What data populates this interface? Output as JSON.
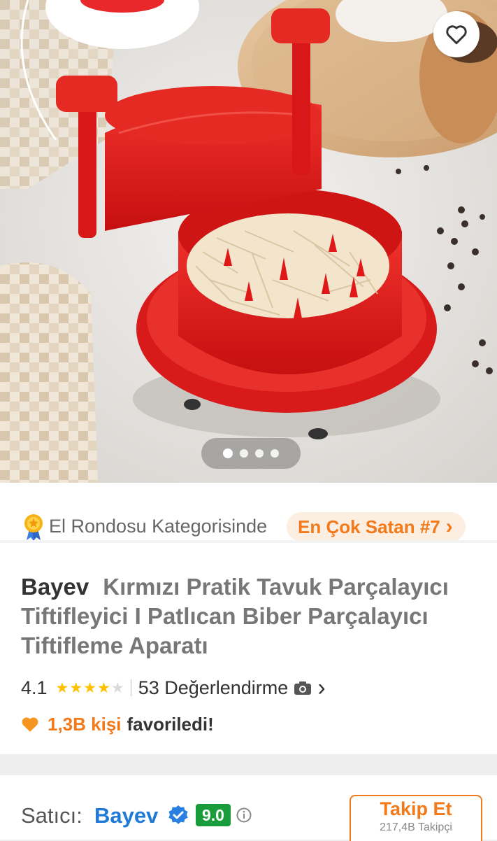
{
  "hero": {
    "pager": {
      "count": 4,
      "active": 0
    }
  },
  "bestseller": {
    "category_text": "El Rondosu Kategorisinde",
    "badge_label": "En Çok Satan #7",
    "badge_chevron": "›"
  },
  "product": {
    "brand": "Bayev",
    "title": "Kırmızı Pratik Tavuk Parçalayıcı Tiftifleyici I Patlıcan Biber Parçalayıcı Tiftifleme Aparatı",
    "rating": "4.1",
    "stars": {
      "filled": 4,
      "total": 5
    },
    "reviews_label": "53 Değerlendirme",
    "review_chevron": "›",
    "favorites_count": "1,3B kişi",
    "favorites_text": "favoriledi!"
  },
  "seller": {
    "label": "Satıcı:",
    "name": "Bayev",
    "score": "9.0",
    "follow_label": "Takip Et",
    "follow_sub": "217,4B Takipçi"
  },
  "colors": {
    "accent": "#f27a1a",
    "badge_bg": "#fdeee2",
    "seller_link": "#1f7ad6",
    "score_green": "#1a9c3a",
    "star": "#ffc000"
  },
  "icons": {
    "favorite": "heart-outline-icon",
    "medal": "medal-icon",
    "camera": "camera-icon",
    "heart_filled": "heart-filled-icon",
    "verified": "verified-check-icon",
    "info": "info-icon"
  }
}
